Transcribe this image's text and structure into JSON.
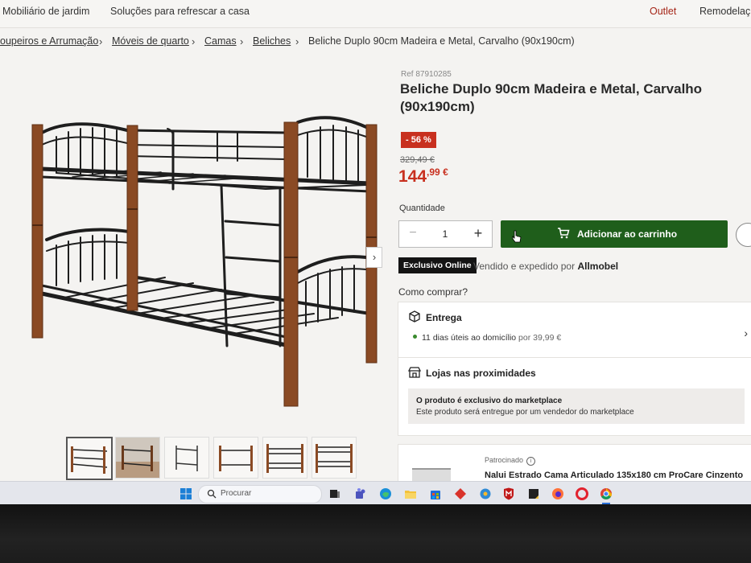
{
  "topnav": {
    "items": [
      "Mobiliário de jardim",
      "Soluções para refrescar a casa"
    ],
    "outlet": "Outlet",
    "remodel": "Remodelaç"
  },
  "breadcrumb": {
    "items": [
      "oupeiros e Arrumação",
      "Móveis de quarto",
      "Camas",
      "Beliches"
    ],
    "current": "Beliche Duplo 90cm Madeira e Metal, Carvalho (90x190cm)"
  },
  "product": {
    "ref": "Ref 87910285",
    "title": "Beliche Duplo 90cm Madeira e Metal, Carvalho (90x190cm)",
    "discount": "- 56 %",
    "old_price": "329,49 €",
    "price_main": "144",
    "price_cents": ",99 €",
    "quantity_label": "Quantidade",
    "quantity": "1",
    "add_to_cart": "Adicionar ao carrinho",
    "exclusive": "Exclusivo Online",
    "sold_by_prefix": "Vendido e expedido por ",
    "seller": "Allmobel",
    "how_to_buy": "Como comprar?"
  },
  "delivery": {
    "title": "Entrega",
    "days": "11 dias úteis ao domicílio",
    "price": " por 39,99 €"
  },
  "stores": {
    "title": "Lojas nas proximidades",
    "line1": "O produto é exclusivo do marketplace",
    "line2": "Este produto será entregue por um vendedor do marketplace"
  },
  "sponsored": {
    "label": "Patrocinado",
    "info": "i",
    "title": "Nalui Estrado Cama Articulado 135x180 cm ProCare Cinzento"
  },
  "taskbar": {
    "search_placeholder": "Procurar"
  },
  "colors": {
    "accent_green": "#1f5e1b",
    "price_red": "#c8301f",
    "wood": "#8a4a24",
    "metal": "#1e1e1e"
  }
}
